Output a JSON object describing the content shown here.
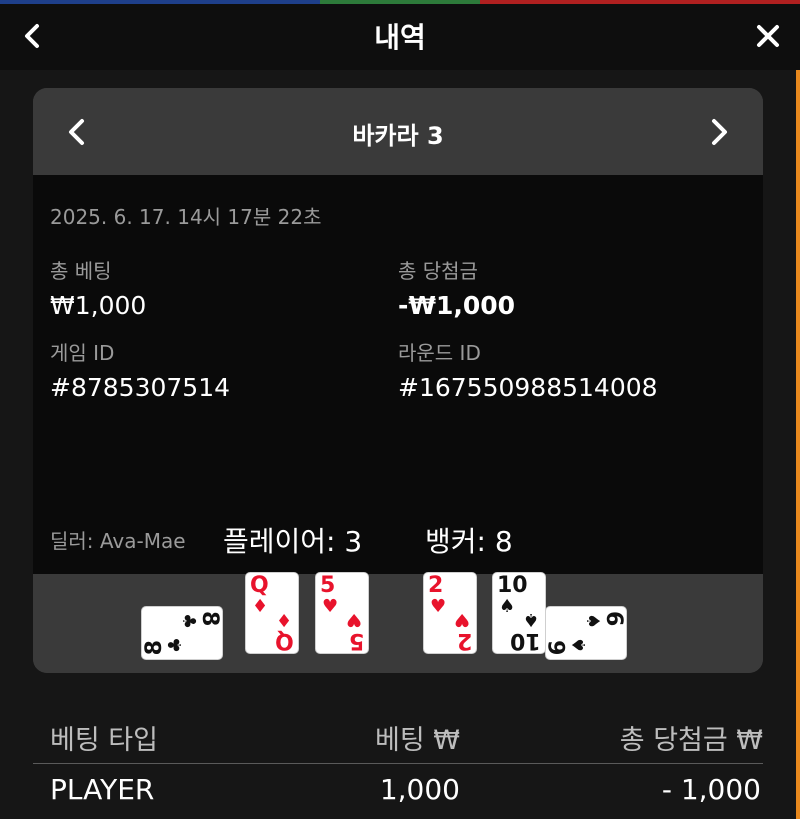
{
  "header": {
    "title": "내역",
    "back_icon": "chevron-left-icon",
    "close_icon": "close-icon",
    "strip_colors": [
      "#1e3f8a",
      "#1e3f8a",
      "#2d7a3a",
      "#b02020",
      "#b02020"
    ]
  },
  "game": {
    "name": "바카라 3",
    "prev_icon": "chevron-left-icon",
    "next_icon": "chevron-right-icon"
  },
  "details": {
    "date": "2025. 6. 17. 14시 17분 22초",
    "total_bet_label": "총 베팅",
    "total_bet_value": "₩1,000",
    "total_win_label": "총 당첨금",
    "total_win_value": "-₩1,000",
    "game_id_label": "게임 ID",
    "game_id_value": "#8785307514",
    "round_id_label": "라운드 ID",
    "round_id_value": "#167550988514008",
    "dealer": "딜러: Ava-Mae"
  },
  "result": {
    "player_label": "플레이어: 3",
    "banker_label": "뱅커: 8",
    "player_cards": [
      {
        "rank": "8",
        "suit": "♣",
        "color": "black",
        "rotated": true
      },
      {
        "rank": "Q",
        "suit": "♦",
        "color": "red",
        "rotated": false
      },
      {
        "rank": "5",
        "suit": "♥",
        "color": "red",
        "rotated": false
      }
    ],
    "banker_cards": [
      {
        "rank": "2",
        "suit": "♥",
        "color": "red",
        "rotated": false
      },
      {
        "rank": "10",
        "suit": "♠",
        "color": "black",
        "rotated": false
      },
      {
        "rank": "6",
        "suit": "♠",
        "color": "black",
        "rotated": true
      }
    ]
  },
  "bets_table": {
    "headers": [
      "베팅 타입",
      "베팅 ₩",
      "총 당첨금 ₩"
    ],
    "rows": [
      [
        "PLAYER",
        "1,000",
        "- 1,000"
      ]
    ]
  },
  "colors": {
    "background": "#161616",
    "header_bg": "#0e0e0e",
    "card_bg": "#3a3a3a",
    "info_bg": "#0a0a0a",
    "accent": "#e8891e",
    "suit_red": "#e8132c"
  }
}
